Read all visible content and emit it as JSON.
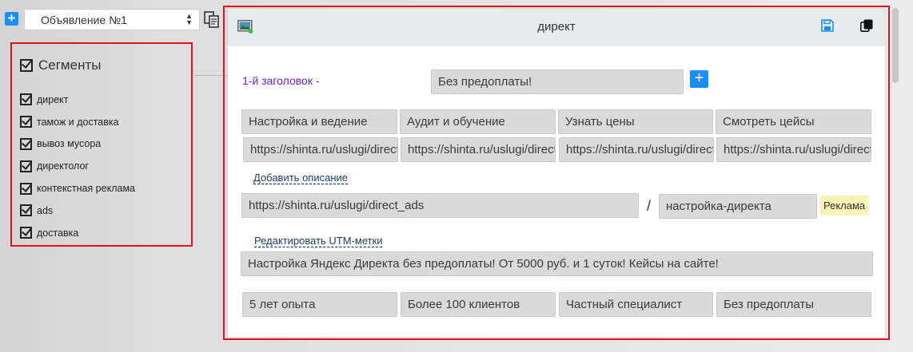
{
  "toolbar": {
    "add_label": "+",
    "ad_select_value": "Объявление №1"
  },
  "segments": {
    "title": "Сегменты",
    "items": [
      {
        "label": "директ"
      },
      {
        "label": "тамож и доставка"
      },
      {
        "label": "вывоз мусора"
      },
      {
        "label": "директолог"
      },
      {
        "label": "контекстная реклама"
      },
      {
        "label": "ads"
      },
      {
        "label": "доставка"
      }
    ]
  },
  "ad": {
    "header_title": "директ",
    "headline_label": "1-й заголовок -",
    "headline_value": "Без предоплаты!",
    "add_headline_label": "+",
    "sitelinks": [
      "Настройка и ведение",
      "Аудит и обучение",
      "Узнать цены",
      "Смотреть цейсы"
    ],
    "sitelink_urls": [
      "https://shinta.ru/uslugi/direct_ads",
      "https://shinta.ru/uslugi/direct_ads",
      "https://shinta.ru/uslugi/direct_ads",
      "https://shinta.ru/uslugi/direct_ads"
    ],
    "add_description_label": "Добавить описание",
    "url_value": "https://shinta.ru/uslugi/direct_ads",
    "slash": "/",
    "display_path": "настройка-директа",
    "ad_badge": "Реклама",
    "edit_utm_label": "Редактировать UTM-метки",
    "text_value": "Настройка Яндекс Директа без предоплаты! От 5000 руб. и 1 суток! Кейсы на сайте!",
    "callouts": [
      "5 лет опыта",
      "Более 100 клиентов",
      "Частный специалист",
      "Без предоплаты"
    ]
  },
  "colors": {
    "accent_blue": "#1a8ef5",
    "highlight_red": "#e0131c",
    "headline_label": "#6a1fd0",
    "badge_yellow": "#fbf3b6"
  }
}
